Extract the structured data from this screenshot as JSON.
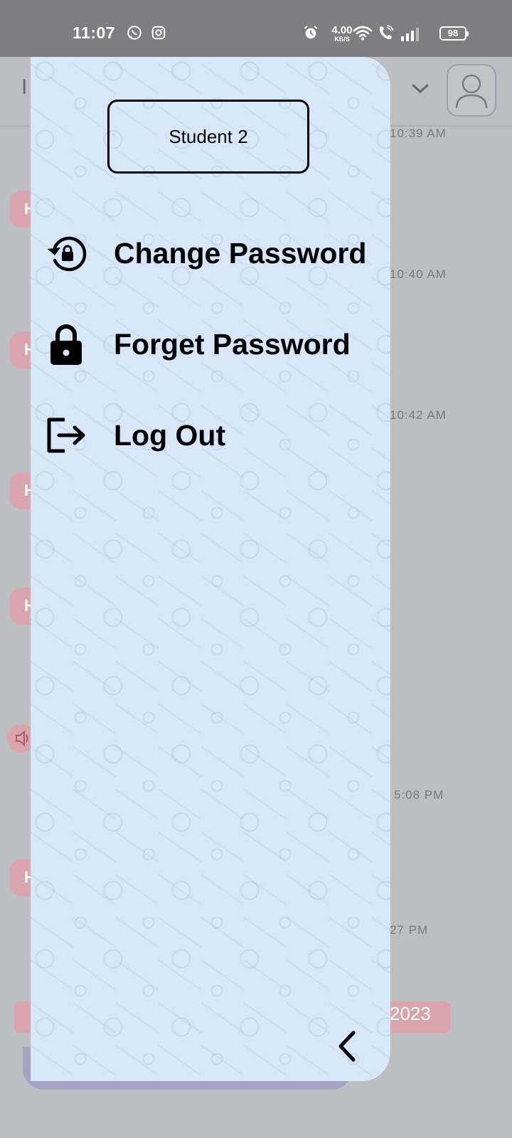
{
  "status_bar": {
    "time": "11:07",
    "net_speed_value": "4.00",
    "net_speed_unit": "KB/S",
    "battery": "98",
    "icons": [
      "whatsapp-icon",
      "instagram-icon",
      "alarm-icon",
      "wifi-icon",
      "wifi-call-icon",
      "signal-icon",
      "battery-icon"
    ]
  },
  "background_chat": {
    "header_letter": "I",
    "timestamps": [
      "10:39 AM",
      "10:40 AM",
      "10:42 AM",
      "5:08 PM",
      "27 PM"
    ],
    "bubble_letter": "H",
    "date_pill_text": "2023"
  },
  "drawer": {
    "profile_name": "Student 2",
    "menu": [
      {
        "label": "Change Password",
        "icon": "lock-reset-icon"
      },
      {
        "label": "Forget Password",
        "icon": "lock-icon"
      },
      {
        "label": "Log Out",
        "icon": "logout-icon"
      }
    ],
    "back_icon": "chevron-left-icon"
  },
  "colors": {
    "status_bar_bg": "#7e7e80",
    "drawer_bg": "#d8e7f8",
    "accent_pink": "#d9a4ab",
    "text": "#000000"
  }
}
